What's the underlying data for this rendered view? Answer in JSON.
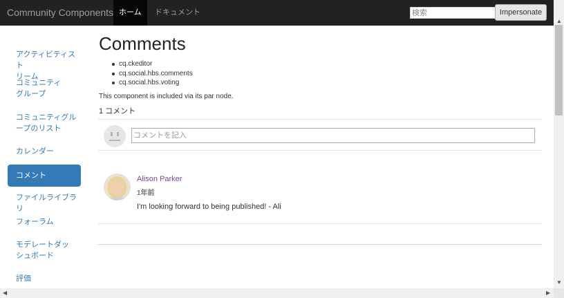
{
  "navbar": {
    "brand": "Community Components",
    "tabs": [
      {
        "label": "ホーム",
        "active": true
      },
      {
        "label": "ドキュメント",
        "active": false
      }
    ],
    "search_placeholder": "検索",
    "impersonate_label": "Impersonate"
  },
  "sidebar": {
    "items": [
      {
        "label": "アクティビティストリーム",
        "lines": [
          "アクティビティスト",
          "リーム"
        ]
      },
      {
        "label": "コミュニティグループ",
        "lines": [
          "コミュニティ",
          "グループ"
        ]
      },
      {
        "label": "コミュニティグループのリスト",
        "lines": [
          "コミュニティグル",
          "ープのリスト"
        ]
      },
      {
        "label": "カレンダー",
        "lines": [
          "カレンダー"
        ]
      },
      {
        "label": "コメント",
        "lines": [
          "コメント"
        ],
        "active": true
      },
      {
        "label": "ファイルライブラリ",
        "lines": [
          "ファイルライブラリ"
        ]
      },
      {
        "label": "フォーラム",
        "lines": [
          "フォーラム"
        ]
      },
      {
        "label": "モデレートダッシュボード",
        "lines": [
          "モデレートダッ",
          "シュボード"
        ]
      },
      {
        "label": "評価",
        "lines": [
          "評価"
        ]
      }
    ]
  },
  "main": {
    "title": "Comments",
    "dependencies": [
      "cq.ckeditor",
      "cq.social.hbs.comments",
      "cq.social.hbs.voting"
    ],
    "note": "This component is included via its par node.",
    "comment_count": "1 コメント",
    "comment_placeholder": "コメントを記入",
    "comments": [
      {
        "author": "Alison Parker",
        "time": "1年前",
        "body": "I'm looking forward to being published! - Ali"
      }
    ]
  },
  "colors": {
    "navbar_bg": "#222222",
    "link": "#337ab7",
    "active_bg": "#337ab7",
    "author": "#7a4a8a"
  },
  "icons": {
    "placeholder_avatar": "neutral-face-icon",
    "scroll_up": "arrow-up-icon",
    "scroll_down": "arrow-down-icon",
    "scroll_left": "arrow-left-icon",
    "scroll_right": "arrow-right-icon"
  }
}
